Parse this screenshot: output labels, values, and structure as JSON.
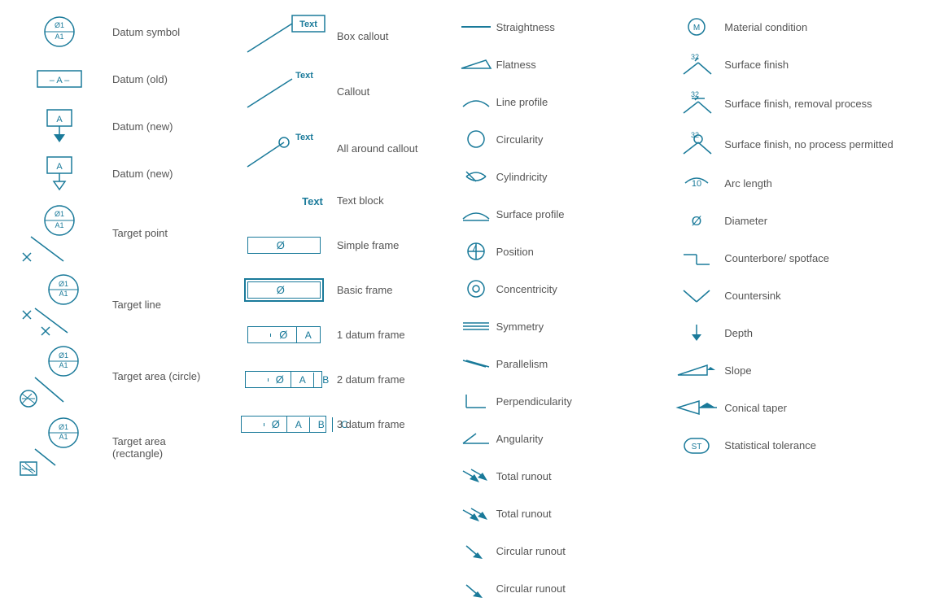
{
  "col1": {
    "items": [
      {
        "id": "datum-symbol",
        "label": "Datum symbol"
      },
      {
        "id": "datum-old",
        "label": "Datum (old)"
      },
      {
        "id": "datum-new1",
        "label": "Datum (new)"
      },
      {
        "id": "datum-new2",
        "label": "Datum (new)"
      },
      {
        "id": "target-point",
        "label": "Target point"
      },
      {
        "id": "target-line",
        "label": "Target line"
      },
      {
        "id": "target-area-circle",
        "label": "Target area (circle)"
      },
      {
        "id": "target-area-rect",
        "label": "Target area (rectangle)"
      }
    ]
  },
  "col2": {
    "items": [
      {
        "id": "box-callout",
        "label": "Box callout"
      },
      {
        "id": "callout",
        "label": "Callout"
      },
      {
        "id": "all-around-callout",
        "label": "All around callout"
      },
      {
        "id": "text-block",
        "label": "Text block"
      },
      {
        "id": "simple-frame",
        "label": "Simple frame"
      },
      {
        "id": "basic-frame",
        "label": "Basic frame"
      },
      {
        "id": "1-datum-frame",
        "label": "1 datum frame"
      },
      {
        "id": "2-datum-frame",
        "label": "2 datum frame"
      },
      {
        "id": "3-datum-frame",
        "label": "3 datum frame"
      }
    ]
  },
  "col3": {
    "items": [
      {
        "id": "straightness",
        "label": "Straightness"
      },
      {
        "id": "flatness",
        "label": "Flatness"
      },
      {
        "id": "line-profile",
        "label": "Line profile"
      },
      {
        "id": "circularity",
        "label": "Circularity"
      },
      {
        "id": "cylindricity",
        "label": "Cylindricity"
      },
      {
        "id": "surface-profile",
        "label": "Surface profile"
      },
      {
        "id": "position",
        "label": "Position"
      },
      {
        "id": "concentricity",
        "label": "Concentricity"
      },
      {
        "id": "symmetry",
        "label": "Symmetry"
      },
      {
        "id": "parallelism",
        "label": "Parallelism"
      },
      {
        "id": "perpendicularity",
        "label": "Perpendicularity"
      },
      {
        "id": "angularity",
        "label": "Angularity"
      },
      {
        "id": "total-runout",
        "label": "Total runout"
      },
      {
        "id": "total-runout2",
        "label": "Total runout"
      },
      {
        "id": "circular-runout",
        "label": "Circular runout"
      },
      {
        "id": "circular-runout2",
        "label": "Circular runout"
      }
    ]
  },
  "col4": {
    "items": [
      {
        "id": "material-condition",
        "label": "Material condition"
      },
      {
        "id": "surface-finish",
        "label": "Surface finish"
      },
      {
        "id": "surface-finish-removal",
        "label": "Surface finish, removal process"
      },
      {
        "id": "surface-finish-no-process",
        "label": "Surface finish, no process permitted"
      },
      {
        "id": "arc-length",
        "label": "Arc length"
      },
      {
        "id": "diameter",
        "label": "Diameter"
      },
      {
        "id": "counterbore",
        "label": "Counterbore/ spotface"
      },
      {
        "id": "countersink",
        "label": "Countersink"
      },
      {
        "id": "depth",
        "label": "Depth"
      },
      {
        "id": "slope",
        "label": "Slope"
      },
      {
        "id": "conical-taper",
        "label": "Conical taper"
      },
      {
        "id": "statistical-tolerance",
        "label": "Statistical tolerance"
      }
    ]
  },
  "colors": {
    "teal": "#1a7a9a",
    "label": "#555555"
  }
}
